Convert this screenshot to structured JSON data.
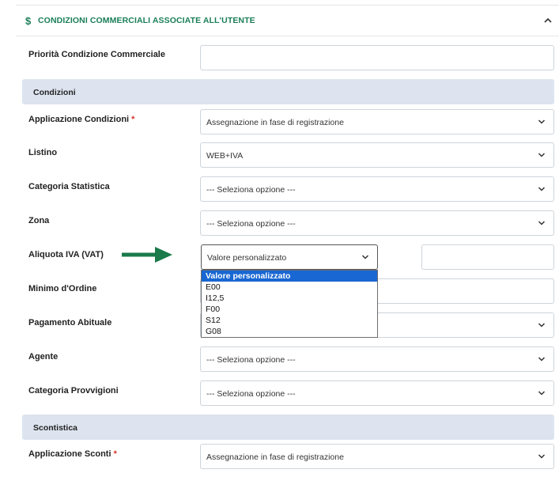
{
  "header": {
    "icon": "dollar-icon",
    "title": "CONDIZIONI COMMERCIALI ASSOCIATE ALL'UTENTE",
    "accent": "#1a7f5a"
  },
  "fields": {
    "priorita": {
      "label": "Priorità Condizione Commerciale",
      "value": ""
    },
    "applicazione_condizioni": {
      "label": "Applicazione Condizioni",
      "required": "*",
      "value": "Assegnazione in fase di registrazione"
    },
    "listino": {
      "label": "Listino",
      "value": "WEB+IVA"
    },
    "categoria_statistica": {
      "label": "Categoria Statistica",
      "value": "--- Seleziona opzione ---"
    },
    "zona": {
      "label": "Zona",
      "value": "--- Seleziona opzione ---"
    },
    "aliquota_iva": {
      "label": "Aliquota IVA (VAT)",
      "value": "Valore personalizzato",
      "custom_value": ""
    },
    "minimo_ordine": {
      "label": "Minimo d'Ordine",
      "value": ""
    },
    "pagamento_abituale": {
      "label": "Pagamento Abituale",
      "value": ""
    },
    "agente": {
      "label": "Agente",
      "value": "--- Seleziona opzione ---"
    },
    "categoria_provvigioni": {
      "label": "Categoria Provvigioni",
      "value": "--- Seleziona opzione ---"
    },
    "applicazione_sconti": {
      "label": "Applicazione Sconti",
      "required": "*",
      "value": "Assegnazione in fase di registrazione"
    }
  },
  "sections": {
    "condizioni": "Condizioni",
    "scontistica": "Scontistica"
  },
  "iva_dropdown": {
    "options": [
      "Valore personalizzato",
      "E00",
      "I12,5",
      "F00",
      "S12",
      "G08"
    ],
    "selected_index": 0,
    "highlight_color": "#1967d2"
  },
  "annotation": {
    "icon": "green-arrow-icon",
    "color": "#1a7a4a"
  }
}
